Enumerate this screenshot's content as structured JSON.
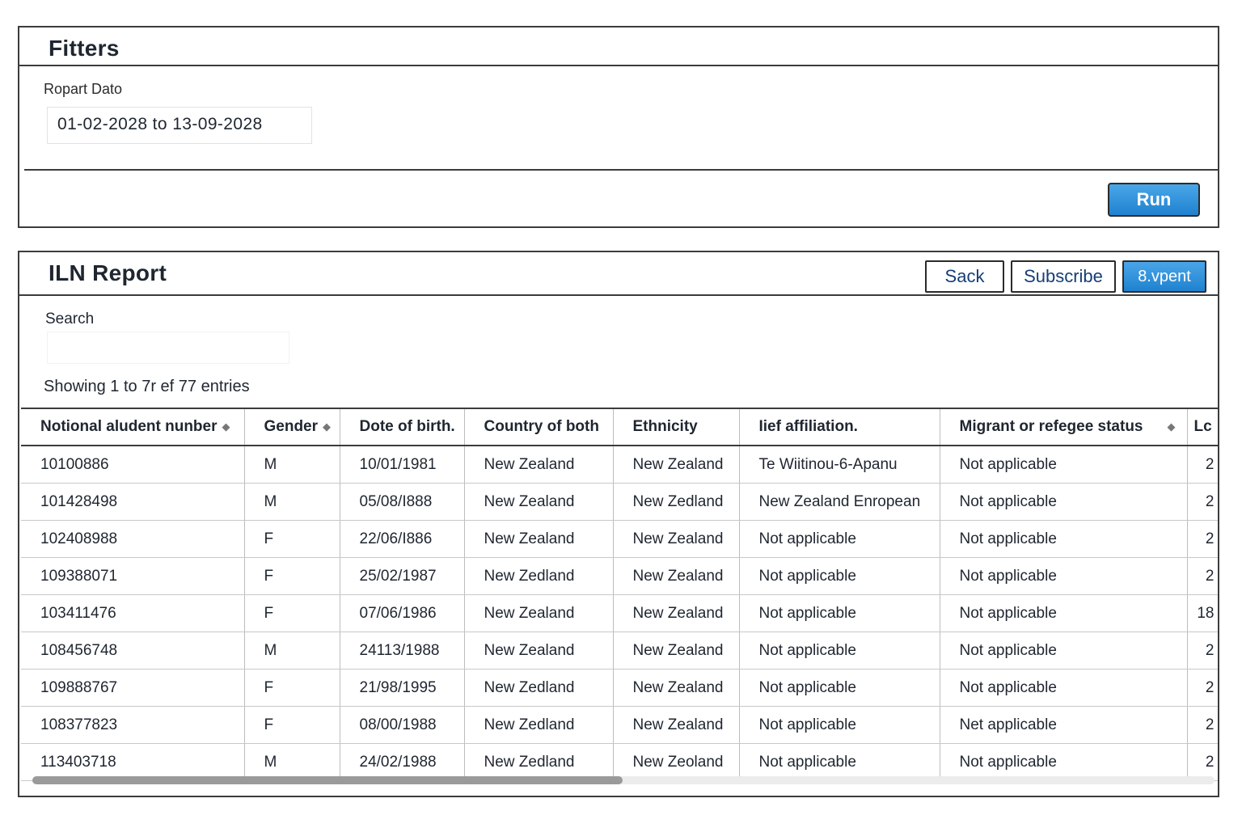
{
  "filters": {
    "title": "Fitters",
    "report_date_label": "Ropart Dato",
    "report_date_value": "01-02-2028 to 13-09-2028",
    "run_label": "Run"
  },
  "report": {
    "title": "ILN Report",
    "buttons": {
      "sack": "Sack",
      "subscribe": "Subscribe",
      "export": "8.vpent"
    },
    "search_label": "Search",
    "search_value": "",
    "entries_text": "Showing 1 to 7r ef 77 entries",
    "columns": [
      "Notional aludent nunber",
      "Gender",
      "Dote of birth.",
      "Country of both",
      "Ethnicity",
      "Iief affiliation.",
      "Migrant or refegee status",
      "Lc"
    ],
    "rows": [
      [
        "10100886",
        "M",
        "10/01/1981",
        "New Zealand",
        "New Zealand",
        "Te Wiitinou-6-Apanu",
        "Not applicable",
        "2"
      ],
      [
        "101428498",
        "M",
        "05/08/I888",
        "New Zealand",
        "New Zedland",
        "New Zealand Enropean",
        "Not applicable",
        "2"
      ],
      [
        "102408988",
        "F",
        "22/06/I886",
        "New Zealand",
        "New Zealand",
        "Not applicable",
        "Not applicable",
        "2"
      ],
      [
        "109388071",
        "F",
        "25/02/1987",
        "New Zedland",
        "New Zealand",
        "Not applicable",
        "Not applicable",
        "2"
      ],
      [
        "103411476",
        "F",
        "07/06/1986",
        "New Zealand",
        "New Zealand",
        "Not applicable",
        "Not applicable",
        "18"
      ],
      [
        "108456748",
        "M",
        "24113/1988",
        "New Zealand",
        "New Zealand",
        "Not applicable",
        "Not applicable",
        "2"
      ],
      [
        "109888767",
        "F",
        "21/98/1995",
        "New Zedland",
        "New Zealand",
        "Not applicable",
        "Not applicable",
        "2"
      ],
      [
        "108377823",
        "F",
        "08/00/1988",
        "New Zedland",
        "New Zealand",
        "Not applicable",
        "Net applicable",
        "2"
      ],
      [
        "113403718",
        "M",
        "24/02/1988",
        "New Zedland",
        "New Zeoland",
        "Not applicable",
        "Not applicable",
        "2"
      ]
    ]
  },
  "colors": {
    "primary_button": "#2a8fdb",
    "border": "#3c3c3c",
    "secondary_text": "#163e76"
  },
  "icons": {
    "sort": "sort-icon"
  }
}
